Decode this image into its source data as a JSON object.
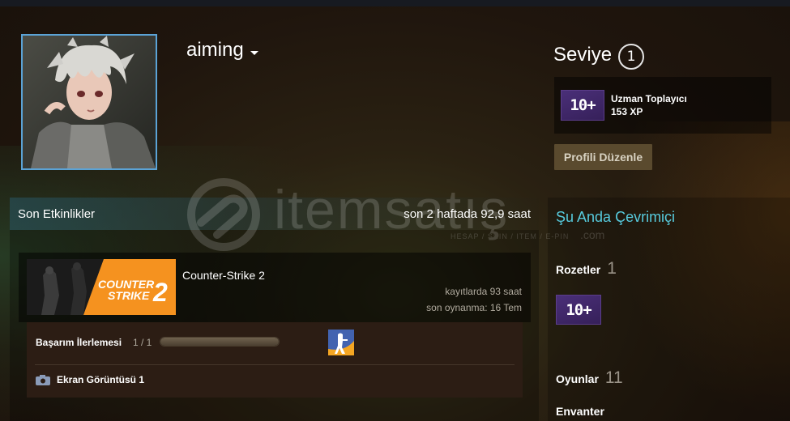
{
  "profile": {
    "username": "aiming"
  },
  "level": {
    "label": "Seviye",
    "value": "1"
  },
  "featured_badge": {
    "icon_text": "10+",
    "title": "Uzman Toplayıcı",
    "xp": "153 XP"
  },
  "edit_profile_label": "Profili Düzenle",
  "activity": {
    "title": "Son Etkinlikler",
    "summary": "son 2 haftada 92,9 saat",
    "game": {
      "name": "Counter-Strike 2",
      "logo_line1": "COUNTER",
      "logo_line2": "STRIKE",
      "logo_num": "2",
      "hours": "kayıtlarda 93 saat",
      "last_played": "son oynanma: 16 Tem",
      "achievements_label": "Başarım İlerlemesi",
      "achievements_count": "1 / 1",
      "achievements_progress": 1.0,
      "screenshot_label": "Ekran Görüntüsü 1"
    }
  },
  "sidebar": {
    "status": "Şu Anda Çevrimiçi",
    "badges_label": "Rozetler",
    "badges_count": "1",
    "badge_icon_text": "10+",
    "games_label": "Oyunlar",
    "games_count": "11",
    "inventory_label": "Envanter"
  },
  "watermark": {
    "text": "itemsatış",
    "sub": "HESAP / SKIN / ITEM / E-PIN",
    "domain": ".com"
  },
  "colors": {
    "accent_online": "#57cbde",
    "avatar_border": "#5ba3d6",
    "badge_purple": "#4a2f78",
    "cs_orange": "#f58a1f"
  },
  "icons": {
    "caret": "chevron-down-icon",
    "camera": "camera-icon",
    "achievement": "cs-achievement-icon"
  }
}
